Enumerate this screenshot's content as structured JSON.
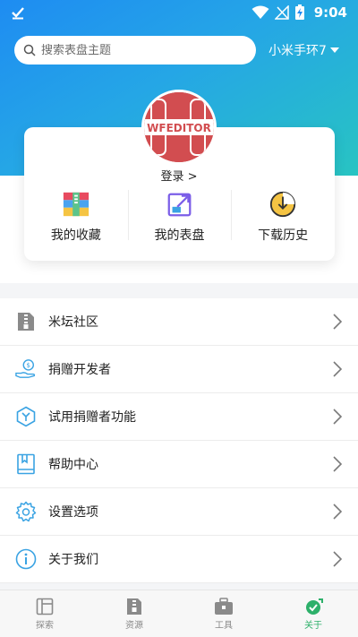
{
  "status_bar": {
    "time": "9:04"
  },
  "search": {
    "placeholder": "搜索表盘主题"
  },
  "device": {
    "selected": "小米手环7"
  },
  "profile": {
    "avatar_text": "WFEDITOR",
    "login_label": "登录 >"
  },
  "quick_actions": [
    {
      "label": "我的收藏",
      "icon": "archive-icon"
    },
    {
      "label": "我的表盘",
      "icon": "export-icon"
    },
    {
      "label": "下载历史",
      "icon": "download-history-icon"
    }
  ],
  "menu": [
    {
      "label": "米坛社区",
      "icon": "zip-file-icon"
    },
    {
      "label": "捐赠开发者",
      "icon": "donate-hand-icon"
    },
    {
      "label": "试用捐赠者功能",
      "icon": "hexagon-icon"
    },
    {
      "label": "帮助中心",
      "icon": "book-icon"
    },
    {
      "label": "设置选项",
      "icon": "gear-icon"
    },
    {
      "label": "关于我们",
      "icon": "info-icon"
    }
  ],
  "tabs": [
    {
      "label": "探索",
      "icon": "explore-icon"
    },
    {
      "label": "资源",
      "icon": "resource-icon"
    },
    {
      "label": "工具",
      "icon": "toolbox-icon"
    },
    {
      "label": "关于",
      "icon": "about-icon",
      "active": true
    }
  ],
  "colors": {
    "accent": "#2db06a",
    "hero_start": "#1e8cf2",
    "hero_end": "#28c4c2",
    "icon_blue": "#3aa3e3"
  }
}
